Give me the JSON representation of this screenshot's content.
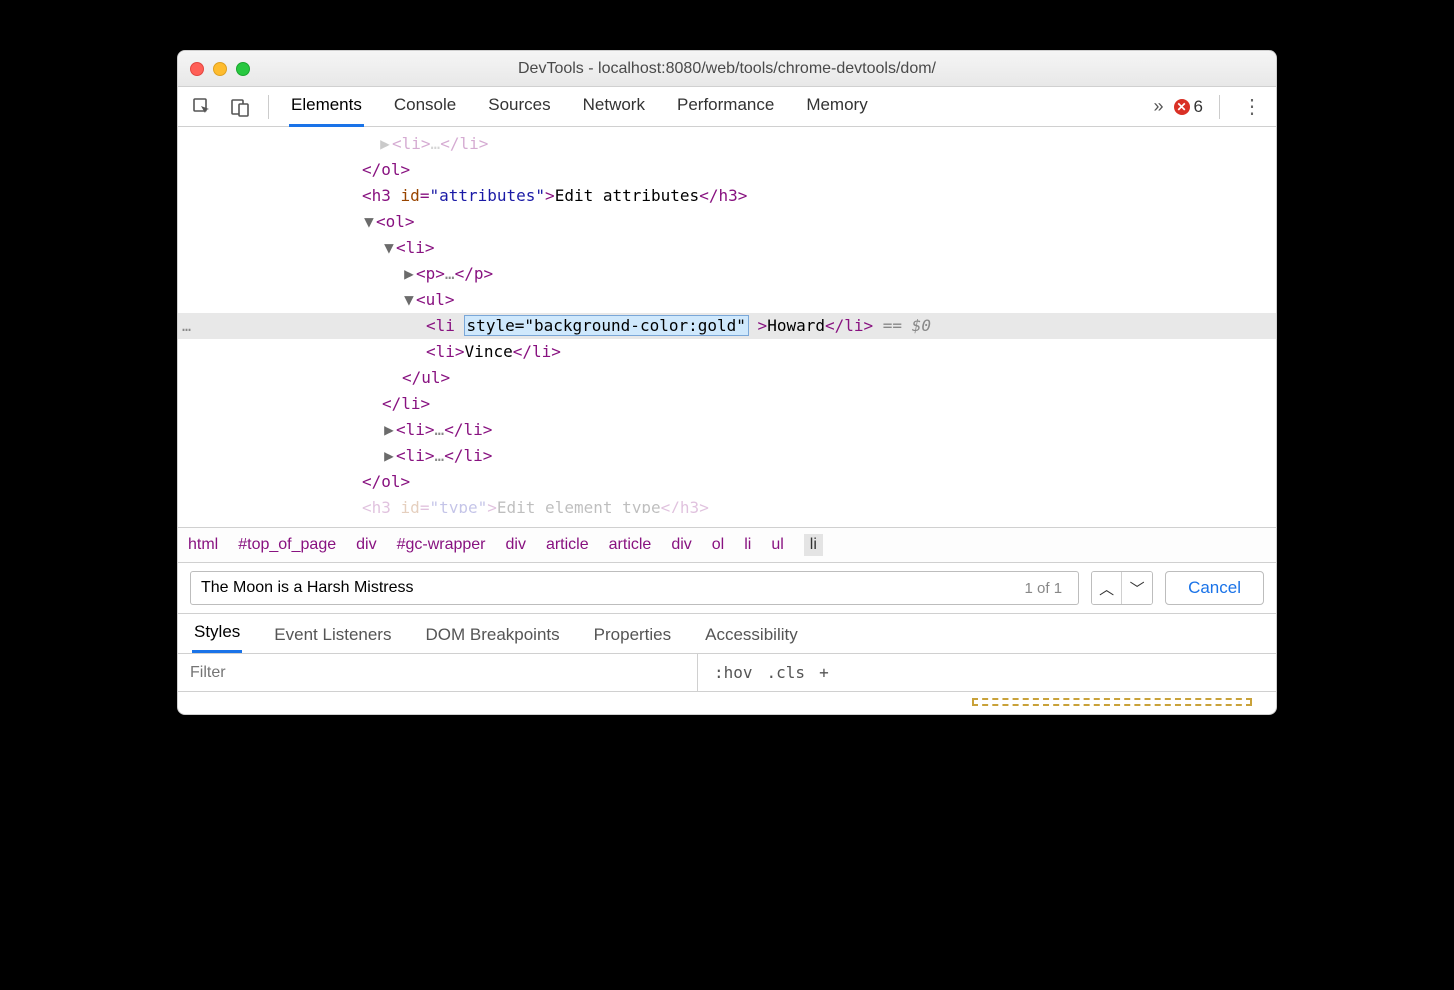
{
  "window": {
    "title": "DevTools - localhost:8080/web/tools/chrome-devtools/dom/"
  },
  "toolbar": {
    "tabs": [
      "Elements",
      "Console",
      "Sources",
      "Network",
      "Performance",
      "Memory"
    ],
    "active_tab": "Elements",
    "overflow_glyph": "»",
    "error_count": "6",
    "more_glyph": "⋮"
  },
  "dom": {
    "lines": [
      {
        "indent": 200,
        "arrow": "▶",
        "parts": [
          {
            "t": "tag",
            "v": "<li>"
          },
          {
            "t": "ellip",
            "v": "…"
          },
          {
            "t": "tag",
            "v": "</li>"
          }
        ],
        "faded_top": true
      },
      {
        "indent": 184,
        "parts": [
          {
            "t": "tag",
            "v": "</ol>"
          }
        ]
      },
      {
        "indent": 184,
        "parts": [
          {
            "t": "tag",
            "v": "<h3 "
          },
          {
            "t": "attrname",
            "v": "id"
          },
          {
            "t": "attreq",
            "v": "="
          },
          {
            "t": "attrval",
            "v": "\"attributes\""
          },
          {
            "t": "tag",
            "v": ">"
          },
          {
            "t": "text",
            "v": "Edit attributes"
          },
          {
            "t": "tag",
            "v": "</h3>"
          }
        ]
      },
      {
        "indent": 184,
        "arrow": "▼",
        "parts": [
          {
            "t": "tag",
            "v": "<ol>"
          }
        ]
      },
      {
        "indent": 204,
        "arrow": "▼",
        "parts": [
          {
            "t": "tag",
            "v": "<li>"
          }
        ]
      },
      {
        "indent": 224,
        "arrow": "▶",
        "parts": [
          {
            "t": "tag",
            "v": "<p>"
          },
          {
            "t": "ellip",
            "v": "…"
          },
          {
            "t": "tag",
            "v": "</p>"
          }
        ]
      },
      {
        "indent": 224,
        "arrow": "▼",
        "parts": [
          {
            "t": "tag",
            "v": "<ul>"
          }
        ]
      },
      {
        "indent": 248,
        "selected": true,
        "parts": [
          {
            "t": "tag",
            "v": "<li "
          },
          {
            "t": "edit",
            "v": "style=\"background-color:gold\""
          },
          {
            "t": "tag",
            "v": " >"
          },
          {
            "t": "text",
            "v": "Howard"
          },
          {
            "t": "tag",
            "v": "</li>"
          },
          {
            "t": "eq",
            "v": " == $0"
          }
        ]
      },
      {
        "indent": 248,
        "parts": [
          {
            "t": "tag",
            "v": "<li>"
          },
          {
            "t": "text",
            "v": "Vince"
          },
          {
            "t": "tag",
            "v": "</li>"
          }
        ]
      },
      {
        "indent": 224,
        "parts": [
          {
            "t": "tag",
            "v": "</ul>"
          }
        ]
      },
      {
        "indent": 204,
        "parts": [
          {
            "t": "tag",
            "v": "</li>"
          }
        ]
      },
      {
        "indent": 204,
        "arrow": "▶",
        "parts": [
          {
            "t": "tag",
            "v": "<li>"
          },
          {
            "t": "ellip",
            "v": "…"
          },
          {
            "t": "tag",
            "v": "</li>"
          }
        ]
      },
      {
        "indent": 204,
        "arrow": "▶",
        "parts": [
          {
            "t": "tag",
            "v": "<li>"
          },
          {
            "t": "ellip",
            "v": "…"
          },
          {
            "t": "tag",
            "v": "</li>"
          }
        ]
      },
      {
        "indent": 184,
        "parts": [
          {
            "t": "tag",
            "v": "</ol>"
          }
        ]
      },
      {
        "indent": 184,
        "cutoff": true,
        "parts": [
          {
            "t": "tag",
            "v": "<h3 "
          },
          {
            "t": "attrname",
            "v": "id"
          },
          {
            "t": "attreq",
            "v": "="
          },
          {
            "t": "attrval",
            "v": "\"type\""
          },
          {
            "t": "tag",
            "v": ">"
          },
          {
            "t": "text",
            "v": "Edit element type"
          },
          {
            "t": "tag",
            "v": "</h3>"
          }
        ]
      }
    ]
  },
  "breadcrumb": [
    "html",
    "#top_of_page",
    "div",
    "#gc-wrapper",
    "div",
    "article",
    "article",
    "div",
    "ol",
    "li",
    "ul",
    "li"
  ],
  "search": {
    "value": "The Moon is a Harsh Mistress",
    "match": "1 of 1",
    "prev_glyph": "︿",
    "next_glyph": "﹀",
    "cancel": "Cancel"
  },
  "subtabs": {
    "items": [
      "Styles",
      "Event Listeners",
      "DOM Breakpoints",
      "Properties",
      "Accessibility"
    ],
    "active": "Styles"
  },
  "styles_toolbar": {
    "filter_placeholder": "Filter",
    "hov": ":hov",
    "cls": ".cls",
    "plus": "+"
  }
}
